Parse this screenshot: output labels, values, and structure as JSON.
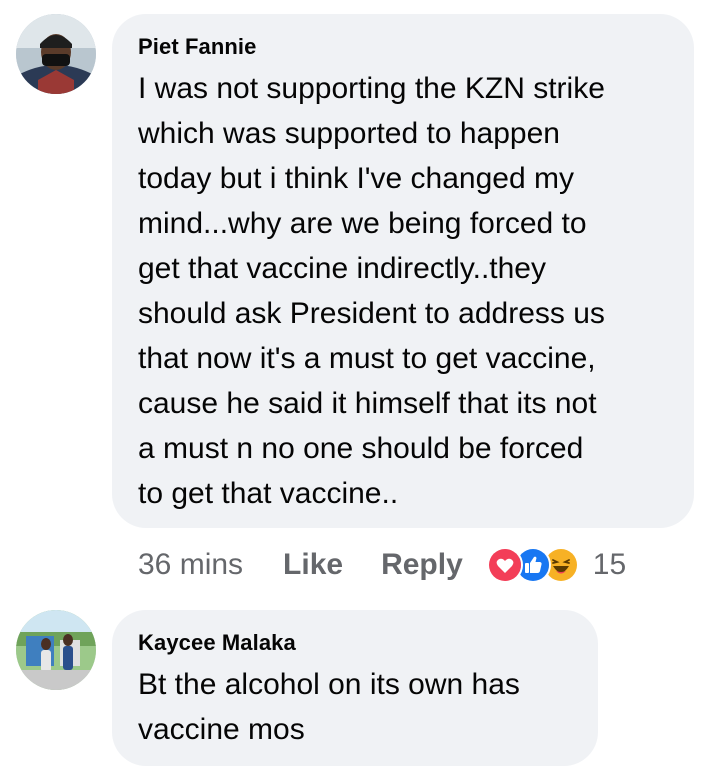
{
  "comments": [
    {
      "author": "Piet Fannie",
      "text": "I was not supporting the KZN strike\nwhich was supported to happen\ntoday but i think I've changed my\nmind...why are we being forced to\nget that vaccine indirectly..they\nshould ask President to address us\nthat now it's a must to get vaccine,\ncause he said it himself that its not\na must n no one should be forced\nto get that vaccine..",
      "time": "36 mins",
      "like_label": "Like",
      "reply_label": "Reply",
      "reactions": [
        "love-reaction-icon",
        "like-reaction-icon",
        "haha-reaction-icon"
      ],
      "reaction_count": "15"
    },
    {
      "author": "Kaycee Malaka",
      "text": "Bt the alcohol on its own has\nvaccine mos"
    }
  ],
  "colors": {
    "bubble": "#f0f2f5",
    "meta_text": "#65676b",
    "love": "#f33e58",
    "like": "#1877f2",
    "haha": "#f7b125"
  }
}
